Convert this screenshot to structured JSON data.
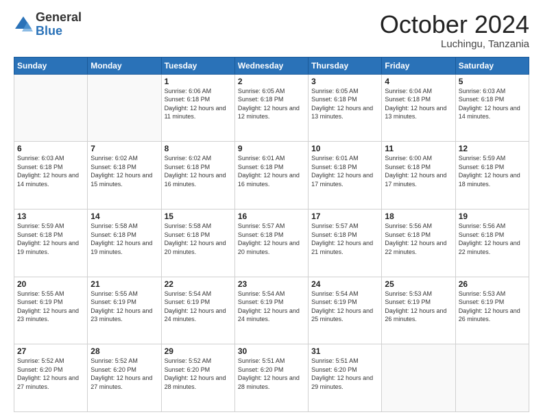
{
  "logo": {
    "general": "General",
    "blue": "Blue"
  },
  "header": {
    "month": "October 2024",
    "location": "Luchingu, Tanzania"
  },
  "weekdays": [
    "Sunday",
    "Monday",
    "Tuesday",
    "Wednesday",
    "Thursday",
    "Friday",
    "Saturday"
  ],
  "weeks": [
    [
      {
        "day": "",
        "info": ""
      },
      {
        "day": "",
        "info": ""
      },
      {
        "day": "1",
        "info": "Sunrise: 6:06 AM\nSunset: 6:18 PM\nDaylight: 12 hours and 11 minutes."
      },
      {
        "day": "2",
        "info": "Sunrise: 6:05 AM\nSunset: 6:18 PM\nDaylight: 12 hours and 12 minutes."
      },
      {
        "day": "3",
        "info": "Sunrise: 6:05 AM\nSunset: 6:18 PM\nDaylight: 12 hours and 13 minutes."
      },
      {
        "day": "4",
        "info": "Sunrise: 6:04 AM\nSunset: 6:18 PM\nDaylight: 12 hours and 13 minutes."
      },
      {
        "day": "5",
        "info": "Sunrise: 6:03 AM\nSunset: 6:18 PM\nDaylight: 12 hours and 14 minutes."
      }
    ],
    [
      {
        "day": "6",
        "info": "Sunrise: 6:03 AM\nSunset: 6:18 PM\nDaylight: 12 hours and 14 minutes."
      },
      {
        "day": "7",
        "info": "Sunrise: 6:02 AM\nSunset: 6:18 PM\nDaylight: 12 hours and 15 minutes."
      },
      {
        "day": "8",
        "info": "Sunrise: 6:02 AM\nSunset: 6:18 PM\nDaylight: 12 hours and 16 minutes."
      },
      {
        "day": "9",
        "info": "Sunrise: 6:01 AM\nSunset: 6:18 PM\nDaylight: 12 hours and 16 minutes."
      },
      {
        "day": "10",
        "info": "Sunrise: 6:01 AM\nSunset: 6:18 PM\nDaylight: 12 hours and 17 minutes."
      },
      {
        "day": "11",
        "info": "Sunrise: 6:00 AM\nSunset: 6:18 PM\nDaylight: 12 hours and 17 minutes."
      },
      {
        "day": "12",
        "info": "Sunrise: 5:59 AM\nSunset: 6:18 PM\nDaylight: 12 hours and 18 minutes."
      }
    ],
    [
      {
        "day": "13",
        "info": "Sunrise: 5:59 AM\nSunset: 6:18 PM\nDaylight: 12 hours and 19 minutes."
      },
      {
        "day": "14",
        "info": "Sunrise: 5:58 AM\nSunset: 6:18 PM\nDaylight: 12 hours and 19 minutes."
      },
      {
        "day": "15",
        "info": "Sunrise: 5:58 AM\nSunset: 6:18 PM\nDaylight: 12 hours and 20 minutes."
      },
      {
        "day": "16",
        "info": "Sunrise: 5:57 AM\nSunset: 6:18 PM\nDaylight: 12 hours and 20 minutes."
      },
      {
        "day": "17",
        "info": "Sunrise: 5:57 AM\nSunset: 6:18 PM\nDaylight: 12 hours and 21 minutes."
      },
      {
        "day": "18",
        "info": "Sunrise: 5:56 AM\nSunset: 6:18 PM\nDaylight: 12 hours and 22 minutes."
      },
      {
        "day": "19",
        "info": "Sunrise: 5:56 AM\nSunset: 6:18 PM\nDaylight: 12 hours and 22 minutes."
      }
    ],
    [
      {
        "day": "20",
        "info": "Sunrise: 5:55 AM\nSunset: 6:19 PM\nDaylight: 12 hours and 23 minutes."
      },
      {
        "day": "21",
        "info": "Sunrise: 5:55 AM\nSunset: 6:19 PM\nDaylight: 12 hours and 23 minutes."
      },
      {
        "day": "22",
        "info": "Sunrise: 5:54 AM\nSunset: 6:19 PM\nDaylight: 12 hours and 24 minutes."
      },
      {
        "day": "23",
        "info": "Sunrise: 5:54 AM\nSunset: 6:19 PM\nDaylight: 12 hours and 24 minutes."
      },
      {
        "day": "24",
        "info": "Sunrise: 5:54 AM\nSunset: 6:19 PM\nDaylight: 12 hours and 25 minutes."
      },
      {
        "day": "25",
        "info": "Sunrise: 5:53 AM\nSunset: 6:19 PM\nDaylight: 12 hours and 26 minutes."
      },
      {
        "day": "26",
        "info": "Sunrise: 5:53 AM\nSunset: 6:19 PM\nDaylight: 12 hours and 26 minutes."
      }
    ],
    [
      {
        "day": "27",
        "info": "Sunrise: 5:52 AM\nSunset: 6:20 PM\nDaylight: 12 hours and 27 minutes."
      },
      {
        "day": "28",
        "info": "Sunrise: 5:52 AM\nSunset: 6:20 PM\nDaylight: 12 hours and 27 minutes."
      },
      {
        "day": "29",
        "info": "Sunrise: 5:52 AM\nSunset: 6:20 PM\nDaylight: 12 hours and 28 minutes."
      },
      {
        "day": "30",
        "info": "Sunrise: 5:51 AM\nSunset: 6:20 PM\nDaylight: 12 hours and 28 minutes."
      },
      {
        "day": "31",
        "info": "Sunrise: 5:51 AM\nSunset: 6:20 PM\nDaylight: 12 hours and 29 minutes."
      },
      {
        "day": "",
        "info": ""
      },
      {
        "day": "",
        "info": ""
      }
    ]
  ]
}
